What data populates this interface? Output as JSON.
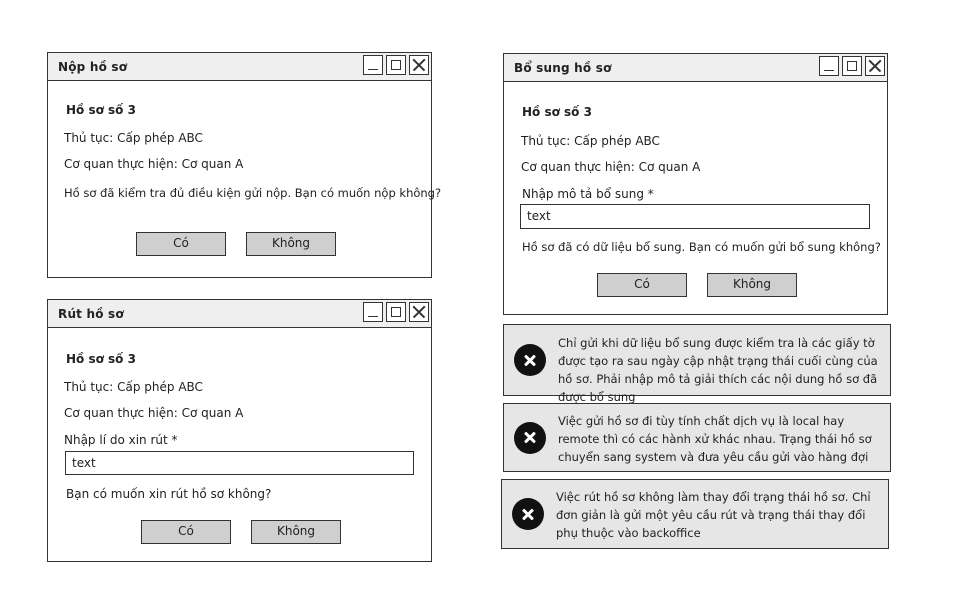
{
  "submit_dialog": {
    "title": "Nộp hồ sơ",
    "record": "Hồ sơ số 3",
    "procedure": "Thủ tục: Cấp phép ABC",
    "agency": "Cơ quan thực hiện: Cơ quan A",
    "message": "Hồ sơ đã kiểm tra đủ điều kiện gửi nộp. Bạn có muốn nộp không?",
    "yes_label": "Có",
    "no_label": "Không"
  },
  "withdraw_dialog": {
    "title": "Rút hồ sơ",
    "record": "Hồ sơ số 3",
    "procedure": "Thủ tục: Cấp phép ABC",
    "agency": "Cơ quan thực hiện: Cơ quan A",
    "reason_label": "Nhập lí do xin rút *",
    "reason_value": "text",
    "message": "Bạn có muốn xin rút hồ sơ không?",
    "yes_label": "Có",
    "no_label": "Không"
  },
  "supplement_dialog": {
    "title": "Bổ sung hồ sơ",
    "record": "Hồ sơ số 3",
    "procedure": "Thủ tục: Cấp phép ABC",
    "agency": "Cơ quan thực hiện: Cơ quan A",
    "desc_label": "Nhập mô tả bổ sung *",
    "desc_value": "text",
    "message": "Hồ sơ đã có dữ liệu bổ sung. Bạn có muốn gửi bổ sung không?",
    "yes_label": "Có",
    "no_label": "Không"
  },
  "notes": [
    {
      "icon": "error-x-icon",
      "text": "Chỉ gửi khi dữ liệu bổ sung được kiểm tra là các giấy tờ được tạo ra sau ngày cập nhật trạng thái cuối cùng của hồ sơ. Phải nhập mô tả giải thích các nội dung hồ sơ đã được bổ sung"
    },
    {
      "icon": "error-x-icon",
      "text": "Việc gửi hồ sơ đi tùy tính chất dịch vụ là local hay remote thì có các hành xử khác nhau. Trạng thái hồ sơ chuyển sang system và đưa yêu cầu gửi vào hàng đợi"
    },
    {
      "icon": "error-x-icon",
      "text": "Việc rút hồ sơ không làm thay đổi trạng thái hồ sơ. Chỉ đơn giản là gửi một yêu cầu rút và trạng thái thay đổi phụ thuộc vào backoffice"
    }
  ]
}
